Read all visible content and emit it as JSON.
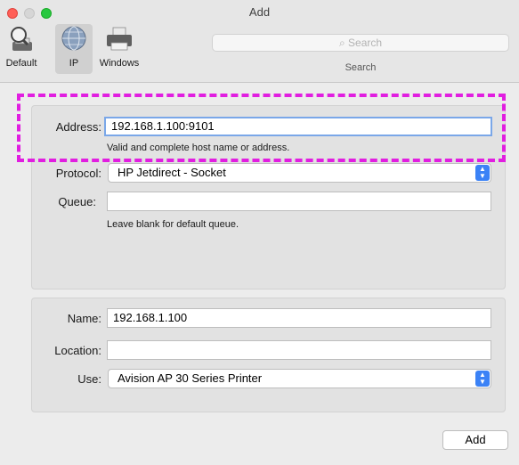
{
  "window": {
    "title": "Add"
  },
  "toolbar": {
    "tabs": [
      {
        "label": "Default",
        "icon": "magnifier-printer-icon"
      },
      {
        "label": "IP",
        "icon": "globe-icon"
      },
      {
        "label": "Windows",
        "icon": "printer-icon"
      }
    ],
    "selected": "IP",
    "search": {
      "placeholder": "Search",
      "caption": "Search"
    }
  },
  "connection": {
    "address_label": "Address:",
    "address_value": "192.168.1.100:9101",
    "address_hint": "Valid and complete host name or address.",
    "protocol_label": "Protocol:",
    "protocol_value": "HP Jetdirect - Socket",
    "queue_label": "Queue:",
    "queue_value": "",
    "queue_hint": "Leave blank for default queue."
  },
  "printer": {
    "name_label": "Name:",
    "name_value": "192.168.1.100",
    "location_label": "Location:",
    "location_value": "",
    "use_label": "Use:",
    "use_value": "Avision AP 30 Series Printer"
  },
  "footer": {
    "add_label": "Add"
  },
  "colors": {
    "highlight": "#e11ee0",
    "accent": "#3b82f6"
  }
}
